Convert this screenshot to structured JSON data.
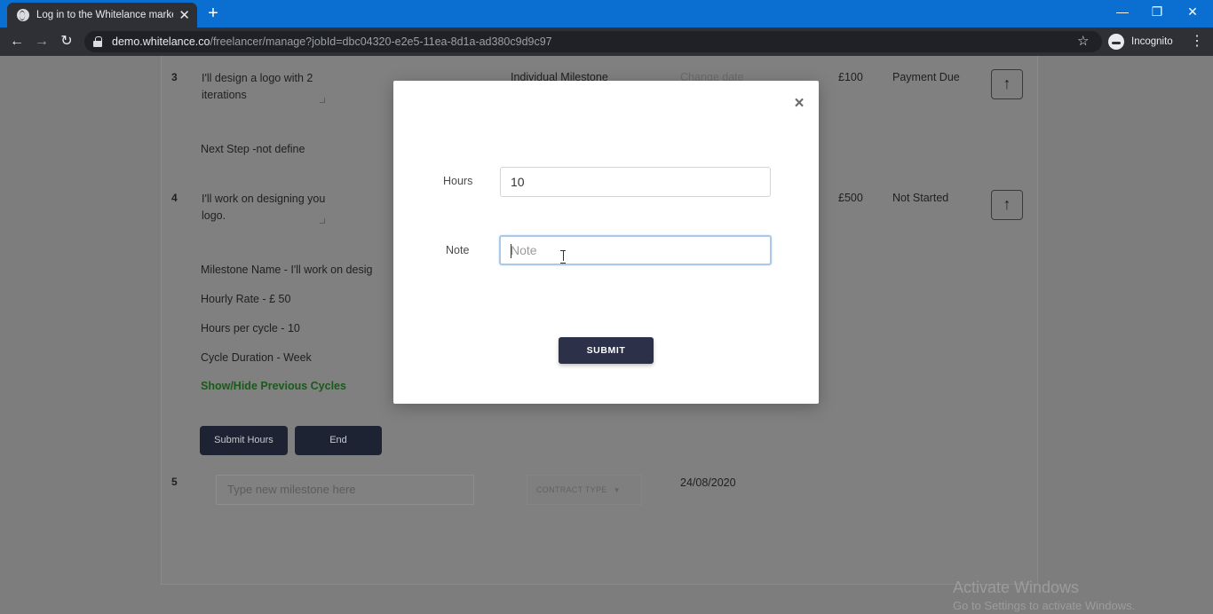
{
  "browser": {
    "tab_title": "Log in to the Whitelance marketplace",
    "tab_close": "✕",
    "new_tab": "+",
    "window_controls": {
      "minimize": "—",
      "maximize": "❐",
      "close": "✕"
    },
    "nav": {
      "back": "←",
      "forward": "→",
      "reload": "↻"
    },
    "url_host": "demo.whitelance.co",
    "url_path": "/freelancer/manage?jobId=dbc04320-e2e5-11ea-8d1a-ad380c9d9c97",
    "bookmark_star": "☆",
    "profile_label": "Incognito",
    "menu": "⋮"
  },
  "milestones": {
    "row3": {
      "number": "3",
      "description": "I'll design a logo with 2 iterations",
      "type": "Individual Milestone",
      "date_action": "Change date",
      "amount": "£100",
      "status": "Payment Due",
      "next_step": "Next Step -not define"
    },
    "row4": {
      "number": "4",
      "description": "I'll work on designing you logo.",
      "amount": "£500",
      "status": "Not Started",
      "details": {
        "name": "Milestone Name - I'll work on desig",
        "rate": "Hourly Rate - £ 50",
        "hours": "Hours per cycle - 10",
        "duration": "Cycle Duration - Week"
      },
      "toggle_link": "Show/Hide Previous Cycles",
      "submit_hours_label": "Submit Hours",
      "end_label": "End"
    },
    "row5": {
      "number": "5",
      "placeholder": "Type new milestone here",
      "contract_type": "CONTRACT TYPE",
      "date": "24/08/2020"
    },
    "up_arrow": "↑"
  },
  "modal": {
    "close": "×",
    "hours_label": "Hours",
    "hours_value": "10",
    "note_label": "Note",
    "note_placeholder": "Note",
    "submit_label": "SUBMIT"
  },
  "watermark": {
    "line1": "Activate Windows",
    "line2": "Go to Settings to activate Windows."
  }
}
